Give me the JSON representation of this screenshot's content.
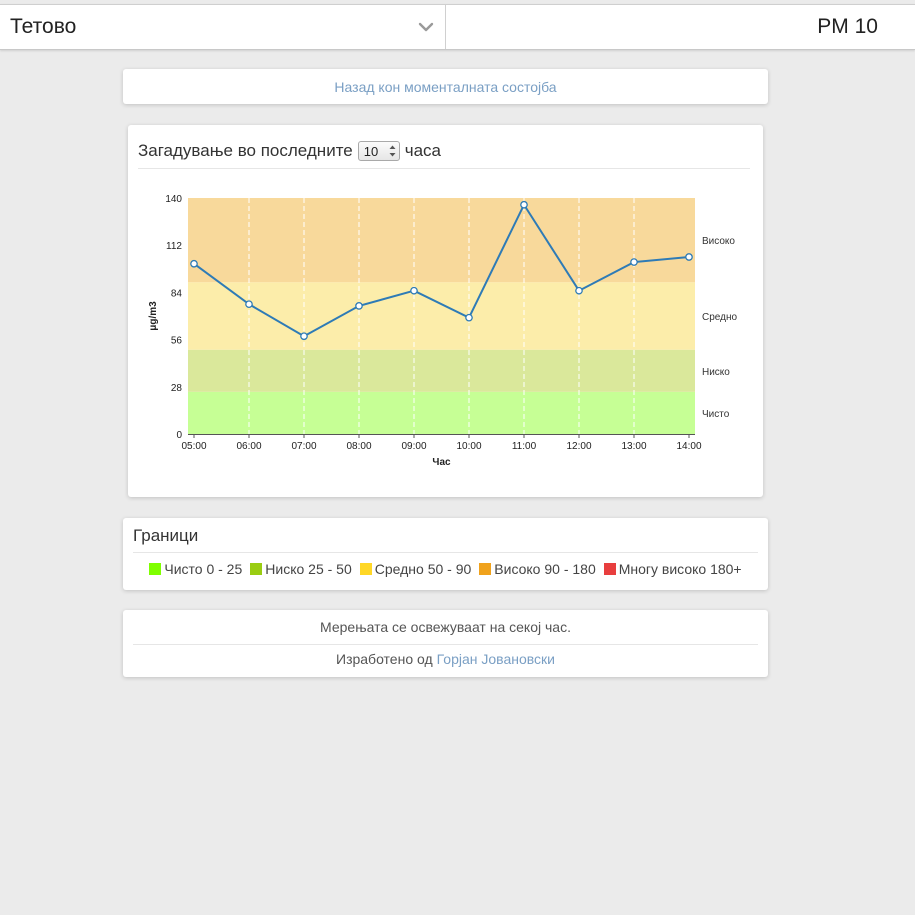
{
  "topbar": {
    "city": "Тетово",
    "parameter": "PM 10"
  },
  "back": {
    "label": "Назад кон моменталната состојба"
  },
  "chart_card": {
    "title_before": "Загадување во последните",
    "hours": "10",
    "title_after": "часа"
  },
  "chart_data": {
    "type": "line",
    "xlabel": "Час",
    "ylabel": "μg/m3",
    "ylim": [
      0,
      140
    ],
    "yticks": [
      0,
      28,
      56,
      84,
      112,
      140
    ],
    "categories": [
      "05:00",
      "06:00",
      "07:00",
      "08:00",
      "09:00",
      "10:00",
      "11:00",
      "12:00",
      "13:00",
      "14:00"
    ],
    "series": [
      {
        "values": [
          101,
          77,
          58,
          76,
          85,
          69,
          136,
          85,
          102,
          105
        ],
        "color": "#2e7bb6"
      }
    ],
    "bands": [
      {
        "label": "Чисто",
        "from": 0,
        "to": 25,
        "color": "#c6ff95"
      },
      {
        "label": "Ниско",
        "from": 25,
        "to": 50,
        "color": "#dae89b"
      },
      {
        "label": "Средно",
        "from": 50,
        "to": 90,
        "color": "#fcedaa"
      },
      {
        "label": "Високо",
        "from": 90,
        "to": 140,
        "color": "#f8d99b"
      }
    ],
    "grid": "vertical-dashed"
  },
  "limits": {
    "title": "Граници",
    "items": [
      {
        "label": "Чисто 0 - 25",
        "color": "#7fff00"
      },
      {
        "label": "Ниско 25 - 50",
        "color": "#9acd12"
      },
      {
        "label": "Средно 50 - 90",
        "color": "#ffd726"
      },
      {
        "label": "Високо 90 - 180",
        "color": "#f0a21c"
      },
      {
        "label": "Многу високо 180+",
        "color": "#e83e3e"
      }
    ]
  },
  "footer": {
    "refresh_text": "Мерењата се освежуваат на секој час.",
    "made_by": "Изработено од",
    "author": "Горјан Јовановски"
  },
  "icons": {
    "city_dropdown": "chevron-down-icon",
    "spinner": "spinner-arrows-icon"
  }
}
